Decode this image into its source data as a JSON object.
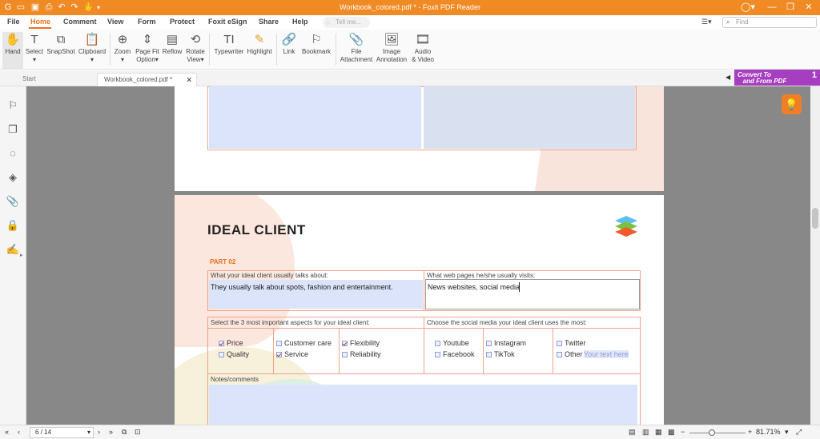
{
  "window": {
    "title": "Workbook_colored.pdf * - Foxit PDF Reader"
  },
  "menu": {
    "items": [
      "File",
      "Home",
      "Comment",
      "View",
      "Form",
      "Protect",
      "Foxit eSign",
      "Share",
      "Help"
    ],
    "tell_me": "Tell me...",
    "find_placeholder": "Find"
  },
  "toolbar": {
    "hand": "Hand",
    "select": "Select",
    "snapshot": "SnapShot",
    "clipboard": "Clipboard",
    "zoom": "Zoom",
    "pagefit1": "Page Fit",
    "pagefit2": "Option",
    "reflow": "Reflow",
    "rotate1": "Rotate",
    "rotate2": "View",
    "typewriter": "Typewriter",
    "highlight": "Highlight",
    "link": "Link",
    "bookmark": "Bookmark",
    "file1": "File",
    "file2": "Attachment",
    "image1": "Image",
    "image2": "Annotation",
    "audio1": "Audio",
    "audio2": "& Video"
  },
  "tabs": {
    "start": "Start",
    "doc": "Workbook_colored.pdf *"
  },
  "convert": {
    "line1": "Convert To",
    "line2": "and From PDF",
    "badge": "1"
  },
  "document": {
    "heading": "IDEAL CLIENT",
    "part": "PART 02",
    "q1": "What your ideal client usually talks about:",
    "a1": "They usually talk about spots, fashion and entertainment.",
    "q2": "What web pages he/she usually visits:",
    "a2": "News websites, social media",
    "q3": "Select the 3 most important aspects for your ideal client:",
    "q4": "Choose the social media your ideal client uses the most:",
    "aspects": [
      "Price",
      "Quality",
      "Customer care",
      "Service",
      "Flexibility",
      "Reliability"
    ],
    "social": [
      "Youtube",
      "Facebook",
      "Instagram",
      "TikTok",
      "Twitter",
      "Other"
    ],
    "other_placeholder": "Your text here",
    "notes": "Notes/comments"
  },
  "status": {
    "page": "6 / 14",
    "zoom": "81.71%"
  },
  "colors": {
    "accent": "#f08a24",
    "field_fill": "#dbe4fb",
    "table_border": "#f0a38a",
    "convert": "#a63ec0"
  }
}
